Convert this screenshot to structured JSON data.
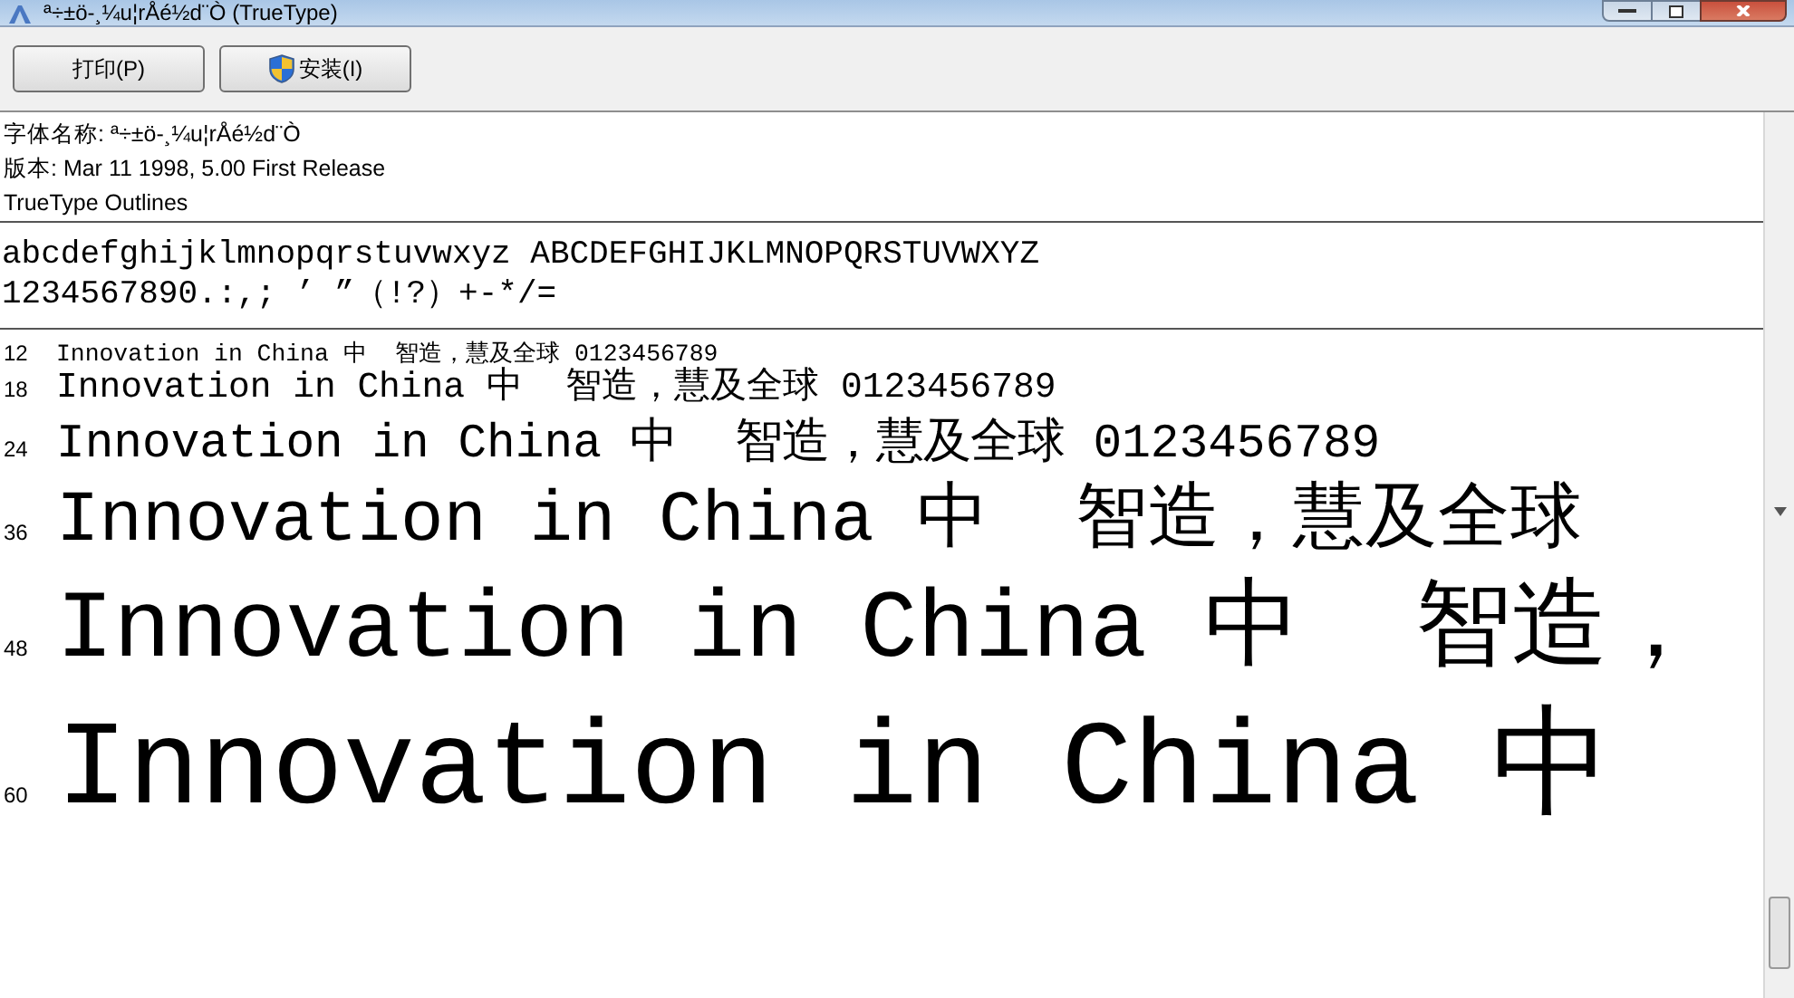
{
  "window": {
    "title": "ª÷±ö-¸¼u¦rÅé½d¨Ò (TrueType)"
  },
  "toolbar": {
    "buttons": [
      {
        "label": "打印(P)",
        "kind": "plain"
      },
      {
        "label": "安装(I)",
        "kind": "shield"
      }
    ]
  },
  "info": {
    "lines": [
      "字体名称: ª÷±ö-¸¼u¦rÅé½d¨Ò",
      "版本: Mar 11 1998, 5.00 First Release",
      "TrueType Outlines"
    ]
  },
  "charset": {
    "lines": [
      "abcdefghijklmnopqrstuvwxyz ABCDEFGHIJKLMNOPQRSTUVWXYZ",
      "1234567890.:,; ’ ”（!?）+-*/="
    ]
  },
  "samples": [
    {
      "size": "12",
      "text": "Innovation in China 中  智造，慧及全球 0123456789"
    },
    {
      "size": "18",
      "text": "Innovation in China 中  智造，慧及全球 0123456789"
    },
    {
      "size": "24",
      "text": "Innovation in China 中  智造，慧及全球 0123456789"
    },
    {
      "size": "36",
      "text": "Innovation in China 中  智造，慧及全球"
    },
    {
      "size": "48",
      "text": "Innovation in China 中  智造，"
    },
    {
      "size": "60",
      "text": "Innovation in China 中"
    }
  ]
}
